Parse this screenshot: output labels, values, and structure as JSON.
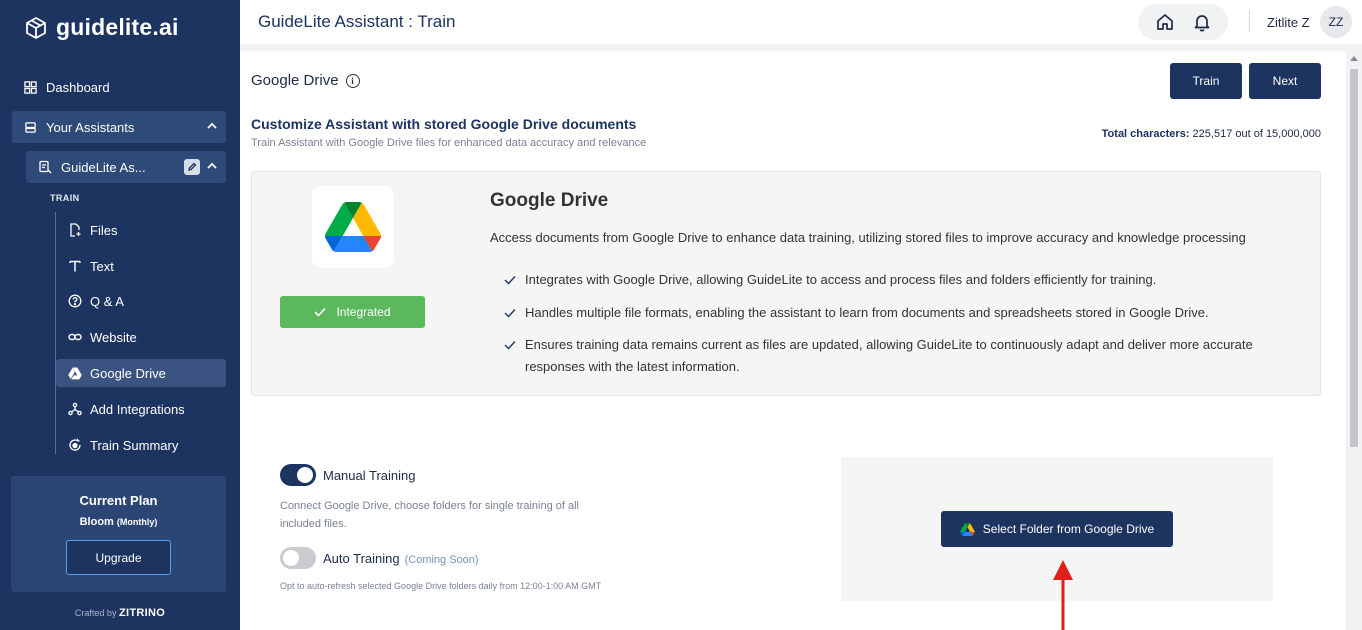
{
  "brand": {
    "name": "guidelite.ai"
  },
  "sidebar": {
    "dashboard": "Dashboard",
    "your_assistants": "Your Assistants",
    "assistant_name": "GuideLite As...",
    "train_label": "TRAIN",
    "train_items": [
      {
        "label": "Files",
        "icon": "file-plus-icon"
      },
      {
        "label": "Text",
        "icon": "text-icon"
      },
      {
        "label": "Q & A",
        "icon": "question-icon"
      },
      {
        "label": "Website",
        "icon": "link-icon"
      },
      {
        "label": "Google Drive",
        "icon": "drive-icon",
        "active": true
      },
      {
        "label": "Add Integrations",
        "icon": "integrations-icon"
      },
      {
        "label": "Train Summary",
        "icon": "summary-icon"
      }
    ],
    "plan": {
      "title": "Current Plan",
      "name": "Bloom",
      "period": "(Monthly)",
      "upgrade_label": "Upgrade"
    },
    "crafted_prefix": "Crafted by",
    "crafted_brand": "ZITRINO"
  },
  "header": {
    "title": "GuideLite Assistant : Train",
    "user_name": "Zitlite Z",
    "avatar_initials": "ZZ"
  },
  "main": {
    "section_title": "Google Drive",
    "train_button": "Train",
    "next_button": "Next",
    "customize_title": "Customize Assistant with stored Google Drive documents",
    "customize_sub": "Train Assistant with Google Drive files for enhanced data accuracy and relevance",
    "total_label": "Total characters:",
    "total_value": "225,517 out of 15,000,000",
    "card": {
      "title": "Google Drive",
      "description": "Access documents from Google Drive to enhance data training, utilizing stored files to improve accuracy and knowledge processing",
      "integrated_label": "Integrated",
      "features": [
        "Integrates with Google Drive, allowing GuideLite to access and process files and folders efficiently for training.",
        "Handles multiple file formats, enabling the assistant to learn from documents and spreadsheets stored in Google Drive.",
        "Ensures training data remains current as files are updated, allowing GuideLite to continuously adapt and deliver more accurate responses with the latest information."
      ]
    },
    "manual_training": {
      "label": "Manual Training",
      "description": "Connect Google Drive, choose folders for single training of all included files."
    },
    "auto_training": {
      "label": "Auto Training",
      "badge": "(Coming Soon)",
      "description": "Opt to auto-refresh selected Google Drive folders daily from 12:00-1:00 AM GMT"
    },
    "select_folder_button": "Select Folder from Google Drive"
  },
  "colors": {
    "navy": "#1d3461",
    "integrated_green": "#5cb85c",
    "arrow_red": "#e0201b"
  }
}
